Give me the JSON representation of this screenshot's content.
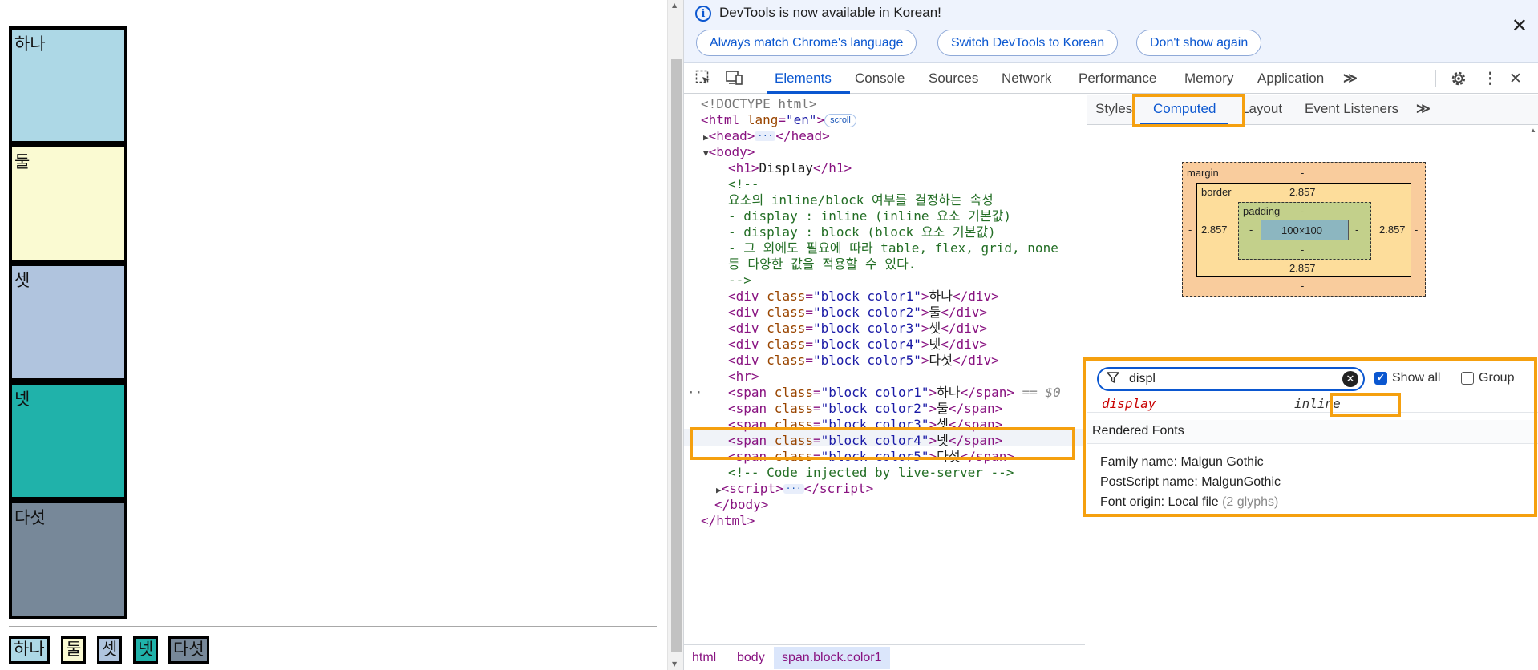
{
  "page": {
    "blocks": [
      "하나",
      "둘",
      "셋",
      "넷",
      "다섯"
    ],
    "inline_blocks": [
      "하나",
      "둘",
      "셋",
      "넷",
      "다섯"
    ],
    "colors": [
      "#add8e6",
      "#fafad2",
      "#b0c4de",
      "#20b2aa",
      "#778899"
    ]
  },
  "devtools": {
    "infobar": {
      "message": "DevTools is now available in Korean!",
      "buttons": [
        "Always match Chrome's language",
        "Switch DevTools to Korean",
        "Don't show again"
      ]
    },
    "tabs": [
      "Elements",
      "Console",
      "Sources",
      "Network",
      "Performance",
      "Memory",
      "Application"
    ],
    "active_tab": "Elements",
    "tree": {
      "doctype": "<!DOCTYPE html>",
      "html_open_tag": "html",
      "html_attr": "lang",
      "html_attr_val": "\"en\"",
      "scroll_badge": "scroll",
      "head_tag": "head",
      "body_tag": "body",
      "h1_tag": "h1",
      "h1_text": "Display",
      "comment_lines": [
        "<!--",
        "요소의 inline/block 여부를 결정하는 속성",
        "- display : inline (inline 요소 기본값)",
        "- display : block (block 요소 기본값)",
        "- 그 외에도 필요에 따라 table, flex, grid, none",
        "등 다양한 값을 적용할 수 있다.",
        "-->"
      ],
      "div_rows": [
        {
          "cls": "\"block color1\"",
          "text": "하나"
        },
        {
          "cls": "\"block color2\"",
          "text": "둘"
        },
        {
          "cls": "\"block color3\"",
          "text": "셋"
        },
        {
          "cls": "\"block color4\"",
          "text": "넷"
        },
        {
          "cls": "\"block color5\"",
          "text": "다섯"
        }
      ],
      "hr_tag": "hr",
      "span_rows": [
        {
          "cls": "\"block color1\"",
          "text": "하나"
        },
        {
          "cls": "\"block color2\"",
          "text": "둘"
        },
        {
          "cls": "\"block color3\"",
          "text": "셋"
        },
        {
          "cls": "\"block color4\"",
          "text": "넷"
        },
        {
          "cls": "\"block color5\"",
          "text": "다섯"
        }
      ],
      "selected_suffix": "== $0",
      "injected_comment": "<!-- Code injected by live-server -->",
      "script_tag": "script"
    },
    "breadcrumbs": [
      "html",
      "body",
      "span.block.color1"
    ],
    "side_tabs": [
      "Styles",
      "Computed",
      "Layout",
      "Event Listeners"
    ],
    "active_side_tab": "Computed",
    "box_model": {
      "margin_label": "margin",
      "margin": "-",
      "border_label": "border",
      "border": "2.857",
      "padding_label": "padding",
      "padding": "-",
      "content": "100×100"
    },
    "filter": {
      "value": "displ",
      "show_all_label": "Show all",
      "show_all_checked": true,
      "group_label": "Group",
      "group_checked": false
    },
    "computed_property": {
      "name": "display",
      "value": "inline"
    },
    "rendered_fonts": {
      "title": "Rendered Fonts",
      "family": "Family name: Malgun Gothic",
      "postscript": "PostScript name: MalgunGothic",
      "origin": "Font origin: Local file",
      "glyphs": "(2 glyphs)"
    }
  }
}
